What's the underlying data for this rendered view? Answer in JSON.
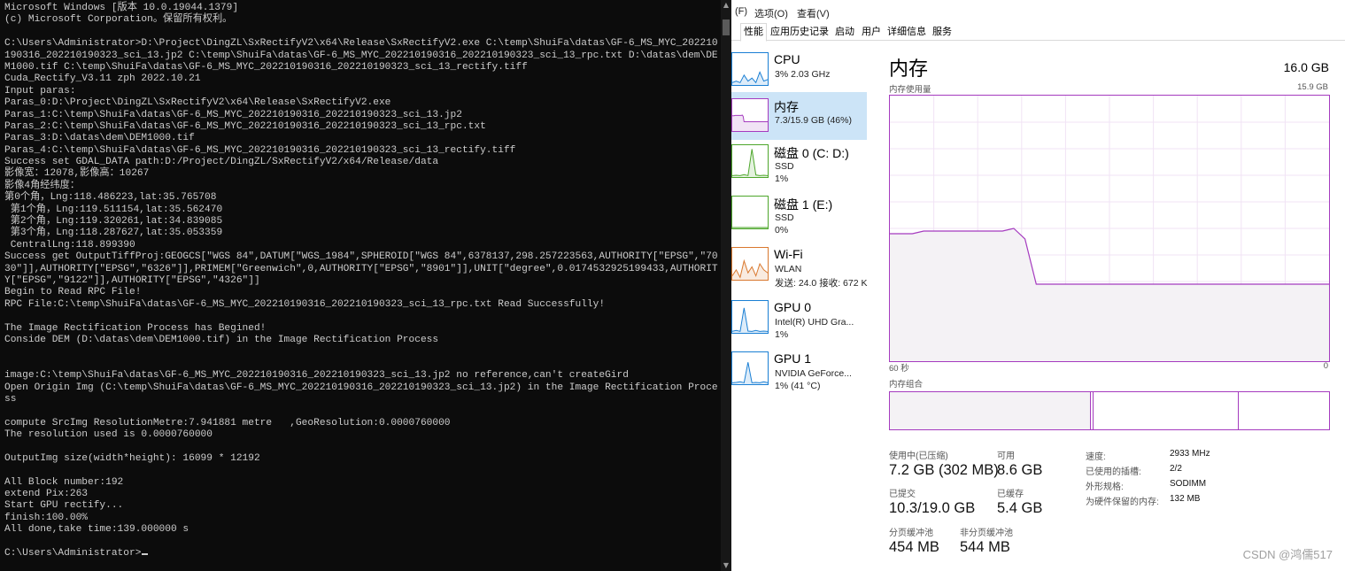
{
  "console": {
    "lines": [
      "Microsoft Windows [版本 10.0.19044.1379]",
      "(c) Microsoft Corporation。保留所有权利。",
      "",
      "C:\\Users\\Administrator>D:\\Project\\DingZL\\SxRectifyV2\\x64\\Release\\SxRectifyV2.exe C:\\temp\\ShuiFa\\datas\\GF-6_MS_MYC_202210",
      "190316_202210190323_sci_13.jp2 C:\\temp\\ShuiFa\\datas\\GF-6_MS_MYC_202210190316_202210190323_sci_13_rpc.txt D:\\datas\\dem\\DE",
      "M1000.tif C:\\temp\\ShuiFa\\datas\\GF-6_MS_MYC_202210190316_202210190323_sci_13_rectify.tiff",
      "Cuda_Rectify_V3.11 zph 2022.10.21",
      "Input paras:",
      "Paras_0:D:\\Project\\DingZL\\SxRectifyV2\\x64\\Release\\SxRectifyV2.exe",
      "Paras_1:C:\\temp\\ShuiFa\\datas\\GF-6_MS_MYC_202210190316_202210190323_sci_13.jp2",
      "Paras_2:C:\\temp\\ShuiFa\\datas\\GF-6_MS_MYC_202210190316_202210190323_sci_13_rpc.txt",
      "Paras_3:D:\\datas\\dem\\DEM1000.tif",
      "Paras_4:C:\\temp\\ShuiFa\\datas\\GF-6_MS_MYC_202210190316_202210190323_sci_13_rectify.tiff",
      "Success set GDAL_DATA path:D:/Project/DingZL/SxRectifyV2/x64/Release/data",
      "影像宽：12078,影像高：10267",
      "影像4角经纬度：",
      "第0个角，Lng:118.486223,lat:35.765708",
      " 第1个角，Lng:119.511154,lat:35.562470",
      " 第2个角，Lng:119.320261,lat:34.839085",
      " 第3个角，Lng:118.287627,lat:35.053359",
      " CentralLng:118.899390",
      "Success get OutputTiffProj:GEOGCS[\"WGS 84\",DATUM[\"WGS_1984\",SPHEROID[\"WGS 84\",6378137,298.257223563,AUTHORITY[\"EPSG\",\"70",
      "30\"]],AUTHORITY[\"EPSG\",\"6326\"]],PRIMEM[\"Greenwich\",0,AUTHORITY[\"EPSG\",\"8901\"]],UNIT[\"degree\",0.0174532925199433,AUTHORIT",
      "Y[\"EPSG\",\"9122\"]],AUTHORITY[\"EPSG\",\"4326\"]]",
      "Begin to Read RPC File!",
      "RPC File:C:\\temp\\ShuiFa\\datas\\GF-6_MS_MYC_202210190316_202210190323_sci_13_rpc.txt Read Successfully!",
      "",
      "The Image Rectification Process has Begined!",
      "Conside DEM (D:\\datas\\dem\\DEM1000.tif) in the Image Rectification Process",
      "",
      "",
      "image:C:\\temp\\ShuiFa\\datas\\GF-6_MS_MYC_202210190316_202210190323_sci_13.jp2 no reference,can't createGird",
      "Open Origin Img (C:\\temp\\ShuiFa\\datas\\GF-6_MS_MYC_202210190316_202210190323_sci_13.jp2) in the Image Rectification Proce",
      "ss",
      "",
      "compute SrcImg ResolutionMetre:7.941881 metre   ,GeoResolution:0.0000760000",
      "The resolution used is 0.0000760000",
      "",
      "OutputImg size(width*height): 16099 * 12192",
      "",
      "All Block number:192",
      "extend Pix:263",
      "Start GPU rectify...",
      "finish:100.00%",
      "All done,take time:139.000000 s",
      "",
      "C:\\Users\\Administrator>"
    ]
  },
  "taskmgr": {
    "menu": [
      "(F)",
      "选项(O)",
      "查看(V)"
    ],
    "tabs": [
      "性能",
      "应用历史记录",
      "启动",
      "用户",
      "详细信息",
      "服务"
    ],
    "sidebar": [
      {
        "name": "CPU",
        "sub1": "3% 2.03 GHz",
        "sub2": "",
        "color": "#1a7fd4",
        "icon": "cpu-graph-icon"
      },
      {
        "name": "内存",
        "sub1": "7.3/15.9 GB (46%)",
        "sub2": "",
        "color": "#a53bbf",
        "icon": "memory-graph-icon"
      },
      {
        "name": "磁盘 0 (C: D:)",
        "sub1": "SSD",
        "sub2": "1%",
        "color": "#4da62b",
        "icon": "disk-graph-icon"
      },
      {
        "name": "磁盘 1 (E:)",
        "sub1": "SSD",
        "sub2": "0%",
        "color": "#4da62b",
        "icon": "disk-graph-icon"
      },
      {
        "name": "Wi-Fi",
        "sub1": "WLAN",
        "sub2": "发送: 24.0 接收: 672 K",
        "color": "#d9782e",
        "icon": "network-graph-icon"
      },
      {
        "name": "GPU 0",
        "sub1": "Intel(R) UHD Gra...",
        "sub2": "1%",
        "color": "#1a7fd4",
        "icon": "gpu-graph-icon"
      },
      {
        "name": "GPU 1",
        "sub1": "NVIDIA GeForce...",
        "sub2": "1% (41 °C)",
        "color": "#1a7fd4",
        "icon": "gpu-graph-icon"
      }
    ],
    "memory": {
      "title": "内存",
      "total": "16.0 GB",
      "usage_label": "内存使用量",
      "usage_max": "15.9 GB",
      "x_left": "60 秒",
      "x_right": "0",
      "composition_label": "内存组合",
      "history_fraction": [
        0.48,
        0.48,
        0.48,
        0.49,
        0.49,
        0.49,
        0.49,
        0.49,
        0.49,
        0.49,
        0.49,
        0.5,
        0.46,
        0.29,
        0.29,
        0.29,
        0.29,
        0.29,
        0.29,
        0.29,
        0.29,
        0.29,
        0.29,
        0.29,
        0.29,
        0.29,
        0.29,
        0.29,
        0.29,
        0.29,
        0.29,
        0.29,
        0.29,
        0.29,
        0.29,
        0.29,
        0.29,
        0.29,
        0.29,
        0.29
      ],
      "stats": {
        "in_use_label": "使用中(已压缩)",
        "in_use": "7.2 GB (302 MB)",
        "available_label": "可用",
        "available": "8.6 GB",
        "committed_label": "已提交",
        "committed": "10.3/19.0 GB",
        "cached_label": "已缓存",
        "cached": "5.4 GB",
        "paged_label": "分页缓冲池",
        "paged": "454 MB",
        "nonpaged_label": "非分页缓冲池",
        "nonpaged": "544 MB"
      },
      "details": [
        {
          "label": "速度:",
          "value": "2933 MHz"
        },
        {
          "label": "已使用的插槽:",
          "value": "2/2"
        },
        {
          "label": "外形规格:",
          "value": "SODIMM"
        },
        {
          "label": "为硬件保留的内存:",
          "value": "132 MB"
        }
      ]
    },
    "colors": {
      "memory": "#a53bbf",
      "memory_fill": "#f4f2f5",
      "selected": "#cce4f7"
    }
  },
  "watermark": "CSDN @鸿儒517"
}
